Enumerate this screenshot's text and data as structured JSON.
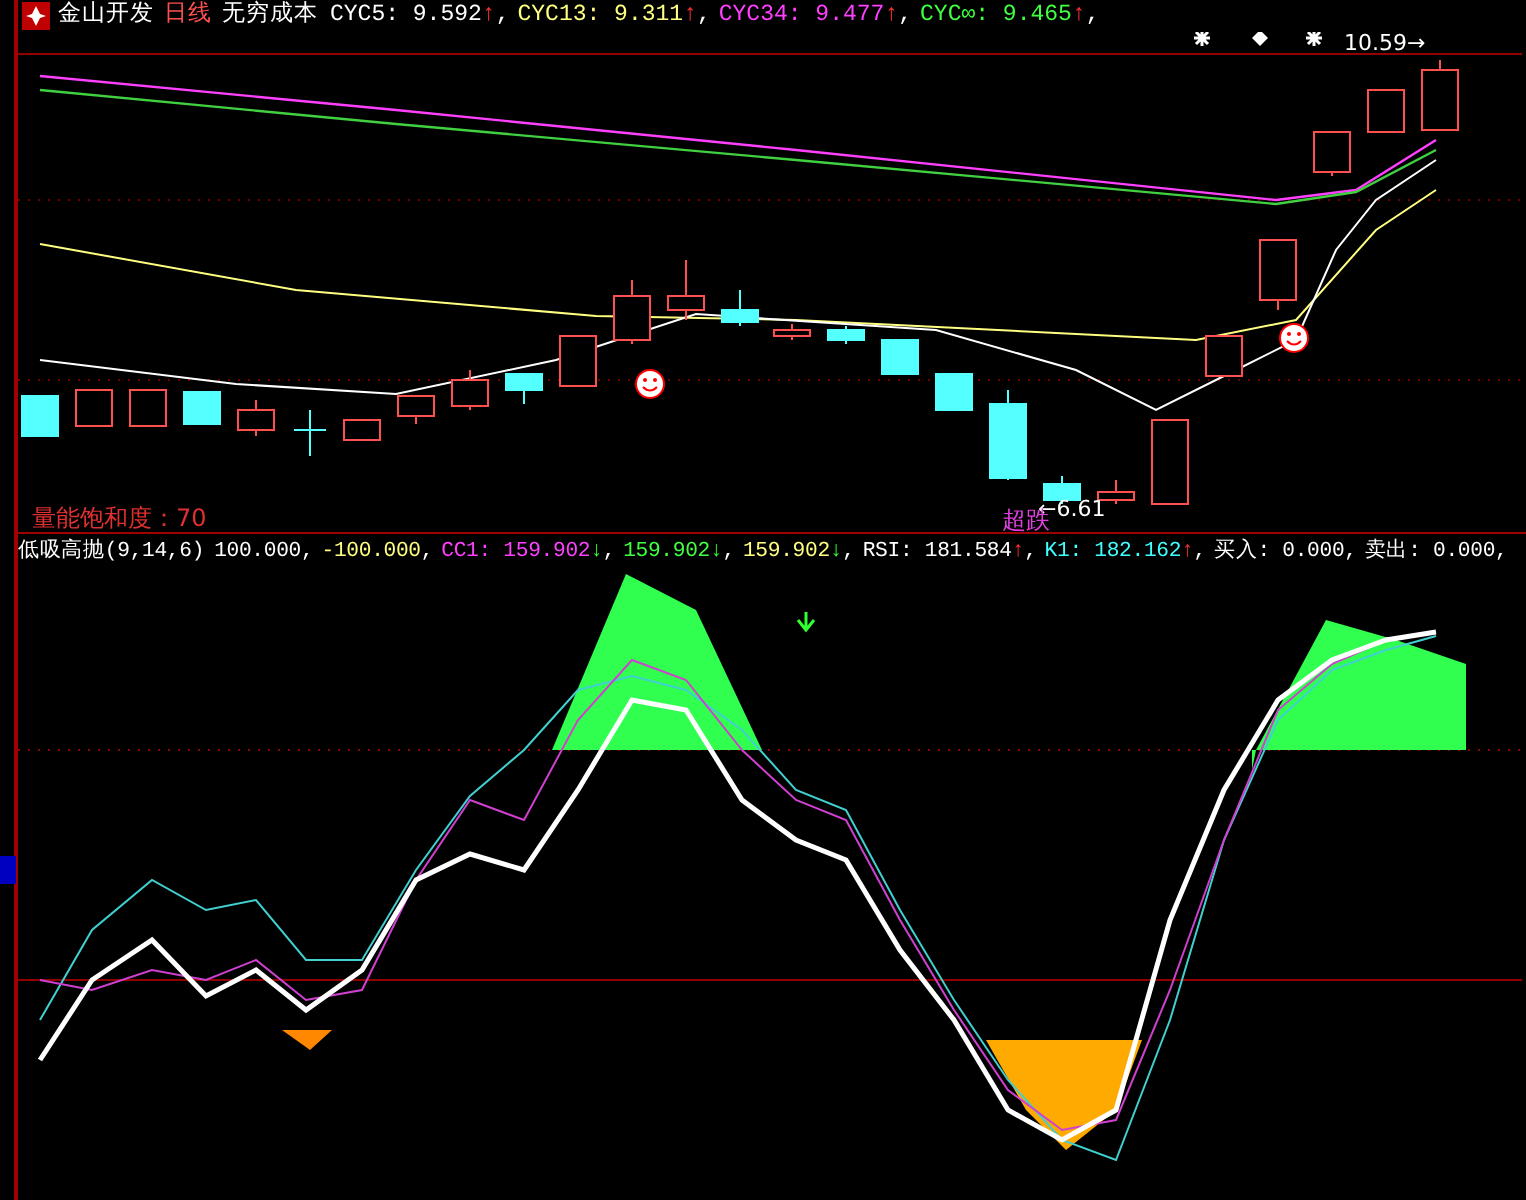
{
  "title_bar": {
    "stock": "金山开发",
    "period": "日线",
    "indicator": "无穷成本",
    "values": [
      {
        "label": "CYC5: 9.592",
        "color": "#ffffff",
        "arrow": "↑",
        "rising": true,
        "punct": ","
      },
      {
        "label": "CYC13: 9.311",
        "color": "#ffff80",
        "arrow": "↑",
        "rising": true,
        "punct": ","
      },
      {
        "label": "CYC34: 9.477",
        "color": "#ff40ff",
        "arrow": "↑",
        "rising": true,
        "punct": ","
      },
      {
        "label": "CYC∞: 9.465",
        "color": "#40ff40",
        "arrow": "↑",
        "rising": true,
        "punct": ","
      }
    ]
  },
  "price_panel": {
    "saturation_label": "量能饱和度：70",
    "high_marker": "10.59→",
    "low_marker": "←6.61",
    "low_tag": "超跌"
  },
  "indicator_panel": {
    "name": "低吸高抛(9,14,6)",
    "values": [
      {
        "label": "100.000",
        "color": "#ffffff",
        "punct": ","
      },
      {
        "label": "-100.000",
        "color": "#ffff80",
        "punct": ","
      },
      {
        "label": "CC1: 159.902",
        "color": "#ff40ff",
        "arrow": "↓",
        "rising": false,
        "punct": ","
      },
      {
        "label": "159.902",
        "color": "#40ff40",
        "arrow": "↓",
        "rising": false,
        "punct": ","
      },
      {
        "label": "159.902",
        "color": "#ffff80",
        "arrow": "↓",
        "rising": false,
        "punct": ","
      },
      {
        "label": "RSI: 181.584",
        "color": "#ffffff",
        "arrow": "↑",
        "rising": true,
        "punct": ","
      },
      {
        "label": "K1: 182.162",
        "color": "#40ffff",
        "arrow": "↑",
        "rising": true,
        "punct": ","
      },
      {
        "label": "买入: 0.000",
        "color": "#ffffff",
        "punct": ","
      },
      {
        "label": "卖出: 0.000",
        "color": "#ffffff",
        "punct": ","
      }
    ]
  }
}
